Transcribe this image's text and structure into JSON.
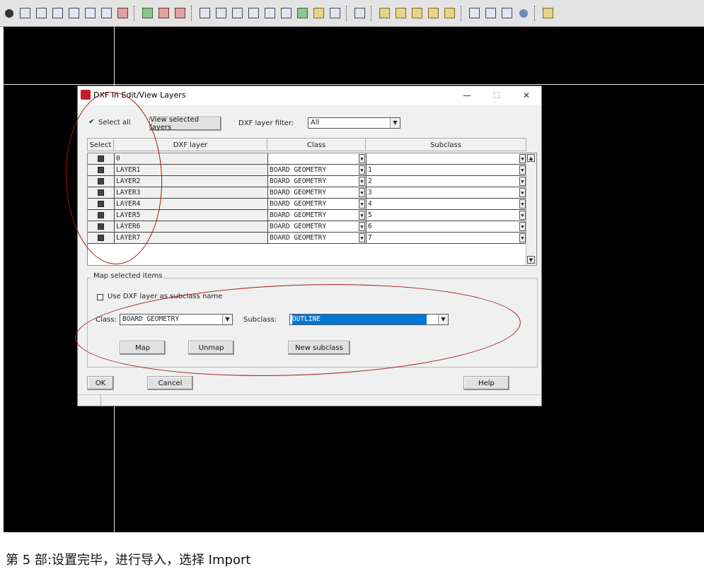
{
  "dialog": {
    "title": "DXF In Edit/View Layers",
    "minimize_icon": "—",
    "maximize_icon": "☐",
    "close_icon": "✕",
    "select_all_label": "Select all",
    "view_selected_button": "View selected layers",
    "filter_label": "DXF layer filter:",
    "filter_value": "All",
    "columns": [
      "Select",
      "DXF layer",
      "Class",
      "Subclass"
    ],
    "rows": [
      {
        "layer": "0",
        "class": "",
        "subclass": ""
      },
      {
        "layer": "LAYER1",
        "class": "BOARD GEOMETRY",
        "subclass": "1"
      },
      {
        "layer": "LAYER2",
        "class": "BOARD GEOMETRY",
        "subclass": "2"
      },
      {
        "layer": "LAYER3",
        "class": "BOARD GEOMETRY",
        "subclass": "3"
      },
      {
        "layer": "LAYER4",
        "class": "BOARD GEOMETRY",
        "subclass": "4"
      },
      {
        "layer": "LAYER5",
        "class": "BOARD GEOMETRY",
        "subclass": "5"
      },
      {
        "layer": "LAYER6",
        "class": "BOARD GEOMETRY",
        "subclass": "6"
      },
      {
        "layer": "LAYER7",
        "class": "BOARD GEOMETRY",
        "subclass": "7"
      }
    ],
    "map_group_title": "Map selected items",
    "use_dxf_layer_label": "Use DXF layer as subclass name",
    "class_label": "Class:",
    "class_value": "BOARD GEOMETRY",
    "subclass_label": "Subclass:",
    "subclass_value": "OUTLINE",
    "map_button": "Map",
    "unmap_button": "Unmap",
    "new_subclass_button": "New subclass",
    "ok_button": "OK",
    "cancel_button": "Cancel",
    "help_button": "Help"
  },
  "caption": "第 5 部:设置完毕，进行导入，选择 Import",
  "colors": {
    "canvas": "#000000",
    "annotation": "#a51616",
    "selection": "#0078d7"
  }
}
